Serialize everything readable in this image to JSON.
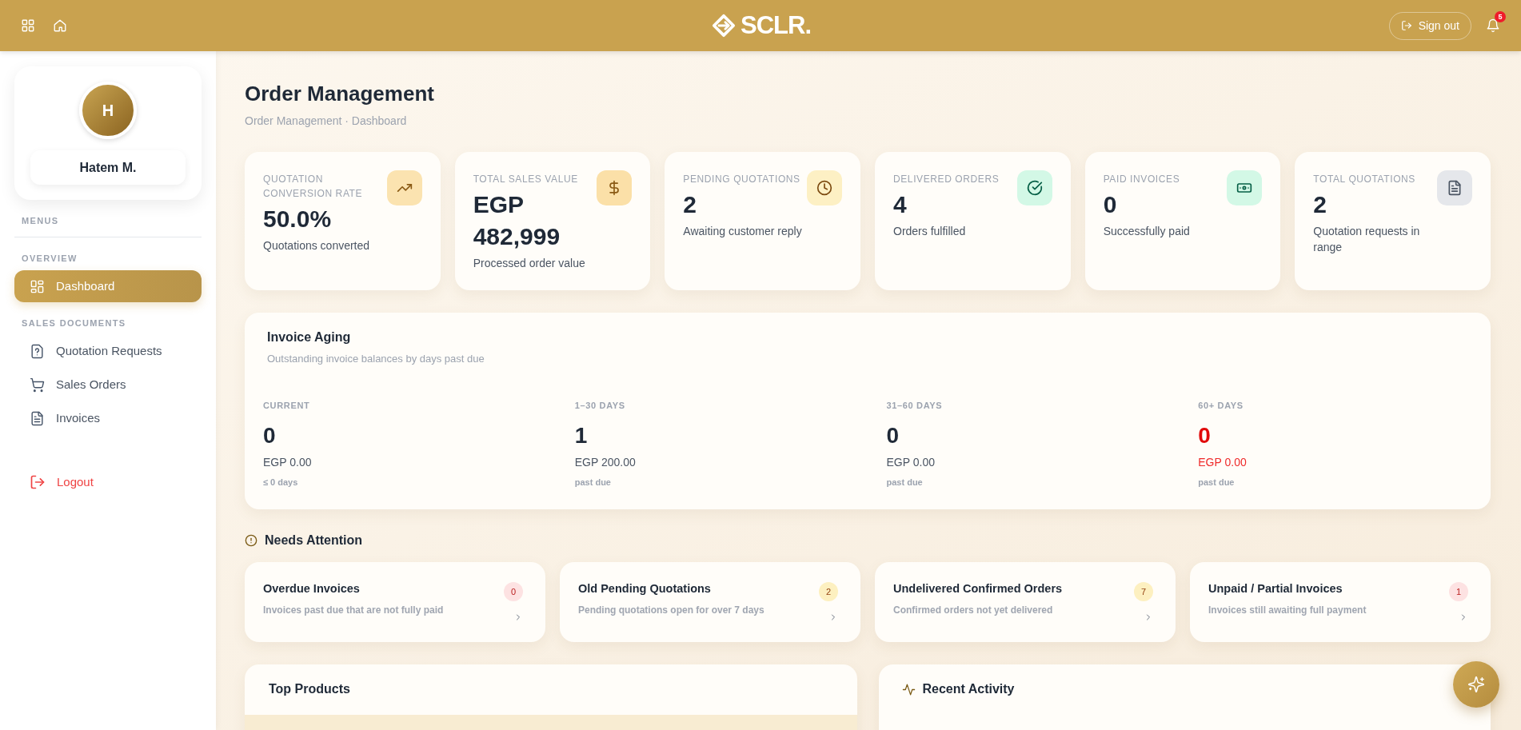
{
  "header": {
    "logo_text": "SCLR.",
    "sign_out": "Sign out",
    "notification_count": "5"
  },
  "sidebar": {
    "user": {
      "initial": "H",
      "name": "Hatem M."
    },
    "menus_label": "MENUS",
    "sections": [
      {
        "title": "OVERVIEW",
        "items": [
          {
            "label": "Dashboard",
            "kind": "dashboard",
            "selected": true
          }
        ]
      },
      {
        "title": "SALES DOCUMENTS",
        "items": [
          {
            "label": "Quotation Requests",
            "kind": "quotations",
            "selected": false
          },
          {
            "label": "Sales Orders",
            "kind": "orders",
            "selected": false
          },
          {
            "label": "Invoices",
            "kind": "invoices",
            "selected": false
          }
        ]
      }
    ],
    "logout": "Logout"
  },
  "page": {
    "title": "Order Management",
    "breadcrumb": "Order Management · Dashboard"
  },
  "kpis": [
    {
      "kind": "conversion",
      "label": "QUOTATION CONVERSION RATE",
      "value": "50.0%",
      "caption": "Quotations converted"
    },
    {
      "kind": "sales",
      "label": "TOTAL SALES VALUE",
      "value": "EGP 482,999",
      "caption": "Processed order value"
    },
    {
      "kind": "pending",
      "label": "PENDING QUOTATIONS",
      "value": "2",
      "caption": "Awaiting customer reply"
    },
    {
      "kind": "delivered",
      "label": "DELIVERED ORDERS",
      "value": "4",
      "caption": "Orders fulfilled"
    },
    {
      "kind": "paid",
      "label": "PAID INVOICES",
      "value": "0",
      "caption": "Successfully paid"
    },
    {
      "kind": "quotations",
      "label": "TOTAL QUOTATIONS",
      "value": "2",
      "caption": "Quotation requests in range"
    }
  ],
  "invoice_aging": {
    "title": "Invoice Aging",
    "subtitle": "Outstanding invoice balances by days past due",
    "buckets": [
      {
        "label": "CURRENT",
        "count": "0",
        "amount": "EGP 0.00",
        "note": "≤ 0 days",
        "alert": false
      },
      {
        "label": "1–30 DAYS",
        "count": "1",
        "amount": "EGP 200.00",
        "note": "past due",
        "alert": false
      },
      {
        "label": "31–60 DAYS",
        "count": "0",
        "amount": "EGP 0.00",
        "note": "past due",
        "alert": false
      },
      {
        "label": "60+ DAYS",
        "count": "0",
        "amount": "EGP 0.00",
        "note": "past due",
        "alert": true
      }
    ]
  },
  "needs_attention": {
    "title": "Needs Attention",
    "items": [
      {
        "title": "Overdue Invoices",
        "description": "Invoices past due that are not fully paid",
        "count": "0",
        "kind": "danger"
      },
      {
        "title": "Old Pending Quotations",
        "description": "Pending quotations open for over 7 days",
        "count": "2",
        "kind": "warning"
      },
      {
        "title": "Undelivered Confirmed Orders",
        "description": "Confirmed orders not yet delivered",
        "count": "7",
        "kind": "warning"
      },
      {
        "title": "Unpaid / Partial Invoices",
        "description": "Invoices still awaiting full payment",
        "count": "1",
        "kind": "danger"
      }
    ]
  },
  "top_products": {
    "title": "Top Products"
  },
  "recent_activity": {
    "title": "Recent Activity"
  }
}
